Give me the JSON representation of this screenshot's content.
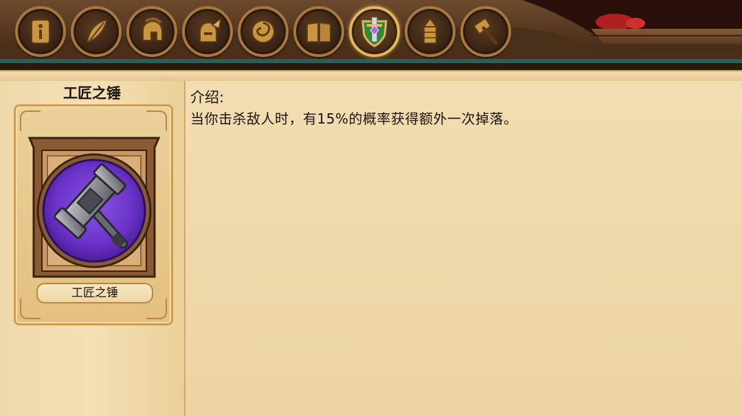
{
  "tabs": [
    {
      "name": "info-scroll",
      "icon": "info-scroll-icon",
      "active": false
    },
    {
      "name": "feather",
      "icon": "feather-icon",
      "active": false
    },
    {
      "name": "helmet",
      "icon": "spartan-helmet-icon",
      "active": false
    },
    {
      "name": "winged-helmet",
      "icon": "winged-helmet-icon",
      "active": false
    },
    {
      "name": "swirl",
      "icon": "swirl-icon",
      "active": false
    },
    {
      "name": "book",
      "icon": "book-icon",
      "active": false
    },
    {
      "name": "shield-sword",
      "icon": "shield-sword-icon",
      "active": true
    },
    {
      "name": "tower",
      "icon": "tower-icon",
      "active": false
    },
    {
      "name": "hammer",
      "icon": "hammer-icon",
      "active": false
    }
  ],
  "item": {
    "title": "工匠之锤",
    "card_label": "工匠之锤",
    "icon": "warhammer-icon"
  },
  "description": {
    "heading": "介绍:",
    "text": "当你击杀敌人时，有15%的概率获得额外一次掉落。"
  },
  "colors": {
    "accent_gold": "#e4b65c",
    "card_background": "#7a3fd6",
    "parchment": "#ecd4a2"
  }
}
